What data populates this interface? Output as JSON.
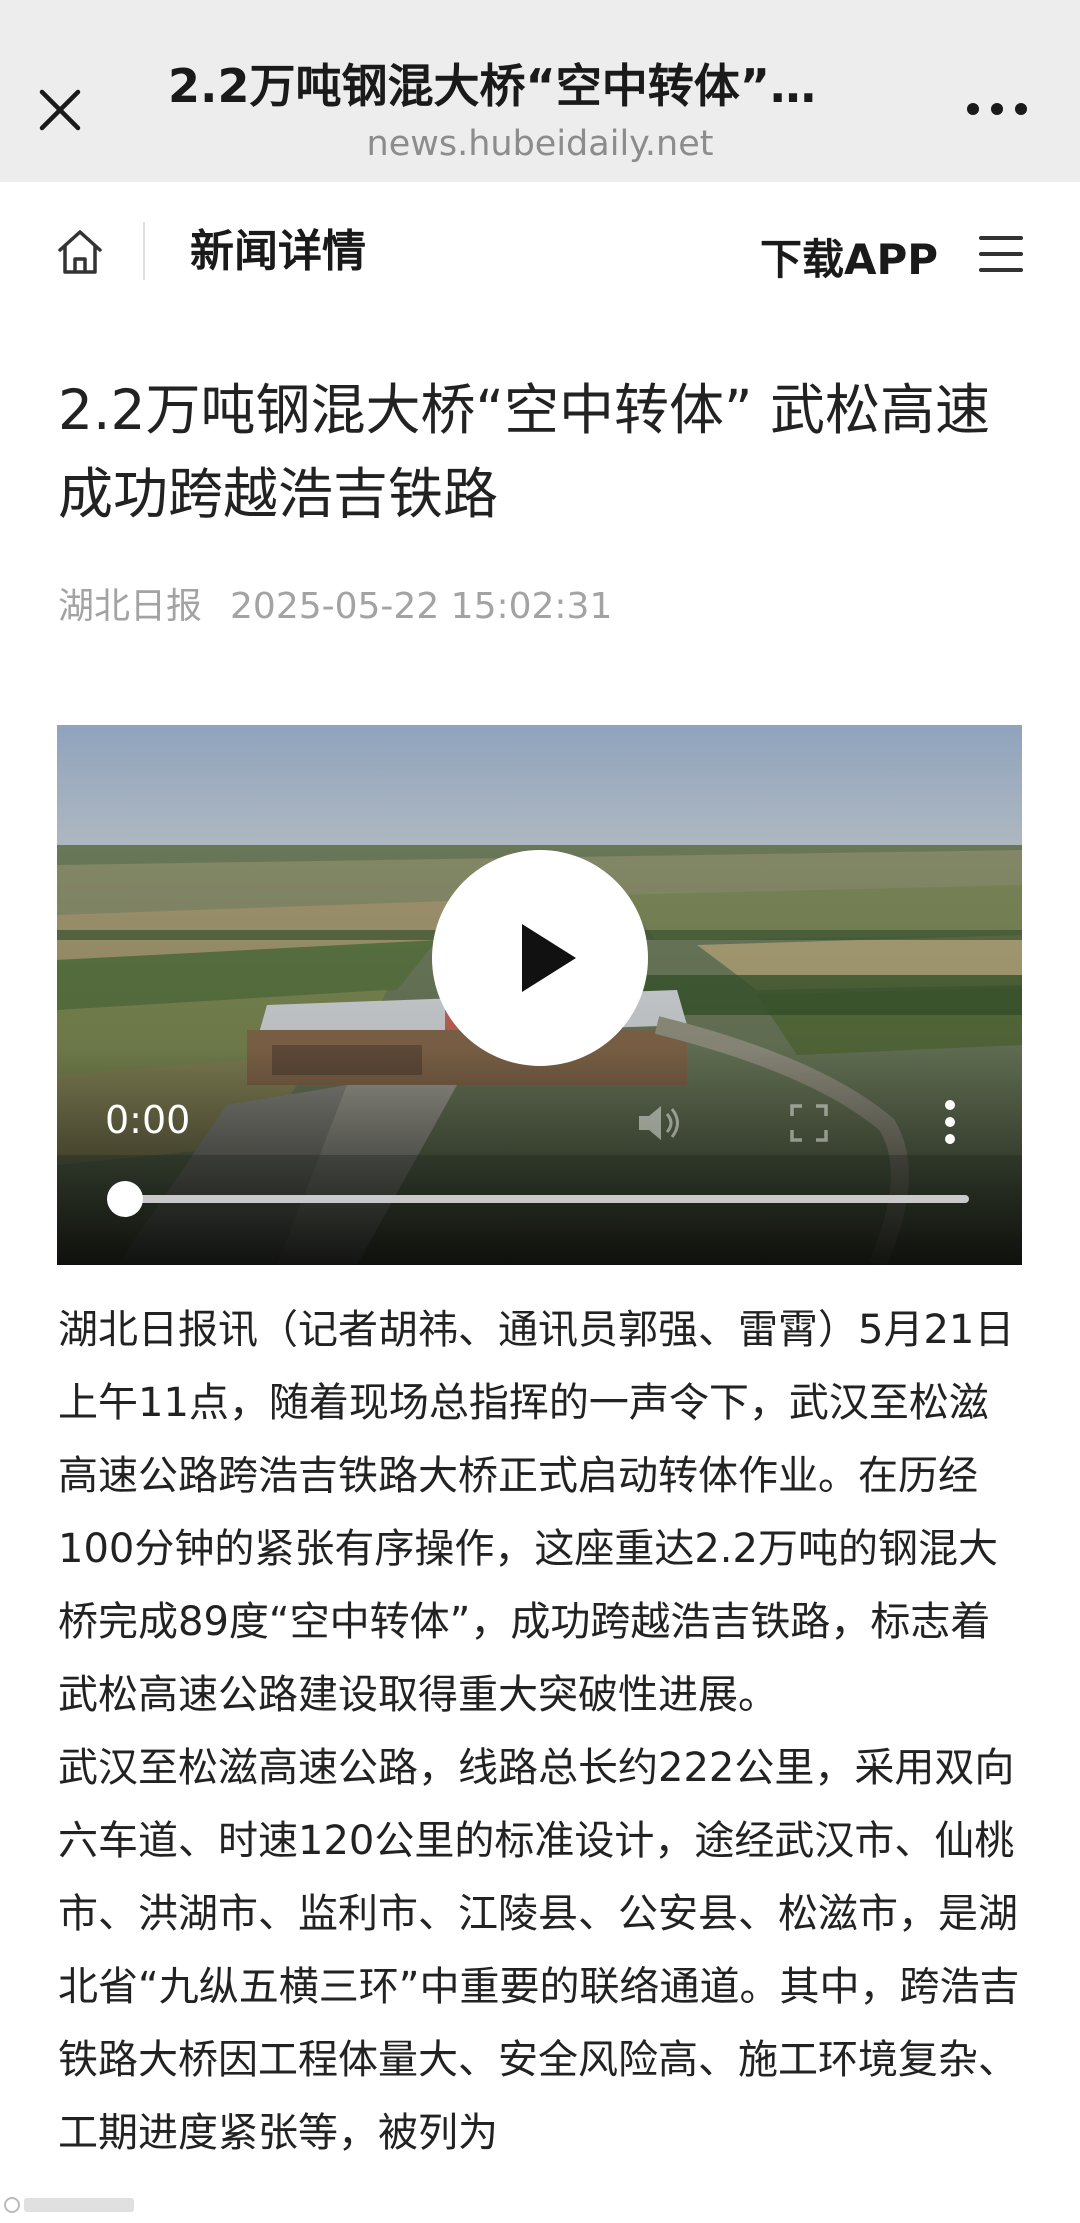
{
  "browser": {
    "title": "2.2万吨钢混大桥“空中转体”…",
    "url": "news.hubeidaily.net",
    "close_icon": "close-icon",
    "more_icon": "more-icon"
  },
  "site_header": {
    "home_icon": "home-icon",
    "title": "新闻详情",
    "download_label": "下载APP",
    "menu_icon": "menu-icon"
  },
  "article": {
    "title": "2.2万吨钢混大桥“空中转体” 武松高速成功跨越浩吉铁路",
    "source": "湖北日报",
    "datetime": "2025-05-22 15:02:31"
  },
  "video": {
    "time": "0:00",
    "progress": 0,
    "play_icon": "play-icon",
    "volume_icon": "volume-icon",
    "fullscreen_icon": "fullscreen-icon",
    "more_icon": "more-vertical-icon"
  },
  "body": {
    "paragraphs": [
      "湖北日报讯（记者胡祎、通讯员郭强、雷霄）5月21日上午11点，随着现场总指挥的一声令下，武汉至松滋高速公路跨浩吉铁路大桥正式启动转体作业。在历经100分钟的紧张有序操作，这座重达2.2万吨的钢混大桥完成89度“空中转体”，成功跨越浩吉铁路，标志着武松高速公路建设取得重大突破性进展。",
      "武汉至松滋高速公路，线路总长约222公里，采用双向六车道、时速120公里的标准设计，途经武汉市、仙桃市、洪湖市、监利市、江陵县、公安县、松滋市，是湖北省“九纵五横三环”中重要的联络通道。其中，跨浩吉铁路大桥因工程体量大、安全风险高、施工环境复杂、工期进度紧张等，被列为"
    ]
  }
}
